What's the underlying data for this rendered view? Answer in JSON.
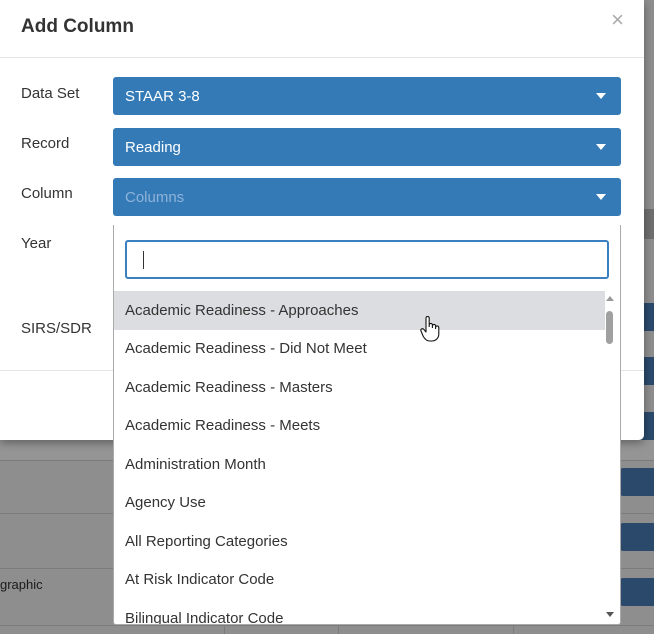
{
  "modal": {
    "title": "Add Column",
    "close_label": "×"
  },
  "form": {
    "data_set": {
      "label": "Data Set",
      "value": "STAAR 3-8"
    },
    "record": {
      "label": "Record",
      "value": "Reading"
    },
    "column": {
      "label": "Column",
      "placeholder": "Columns"
    },
    "year": {
      "label": "Year"
    },
    "sirs_sdr": {
      "label": "SIRS/SDR"
    }
  },
  "dropdown": {
    "search_value": "",
    "options": [
      "Academic Readiness - Approaches",
      "Academic Readiness - Did Not Meet",
      "Academic Readiness - Masters",
      "Academic Readiness - Meets",
      "Administration Month",
      "Agency Use",
      "All Reporting Categories",
      "At Risk Indicator Code",
      "Bilingual Indicator Code"
    ],
    "hovered_index": 0
  },
  "background": {
    "partial_text": "graphic"
  },
  "colors": {
    "primary": "#337ab7",
    "hover": "#dcdde0"
  }
}
